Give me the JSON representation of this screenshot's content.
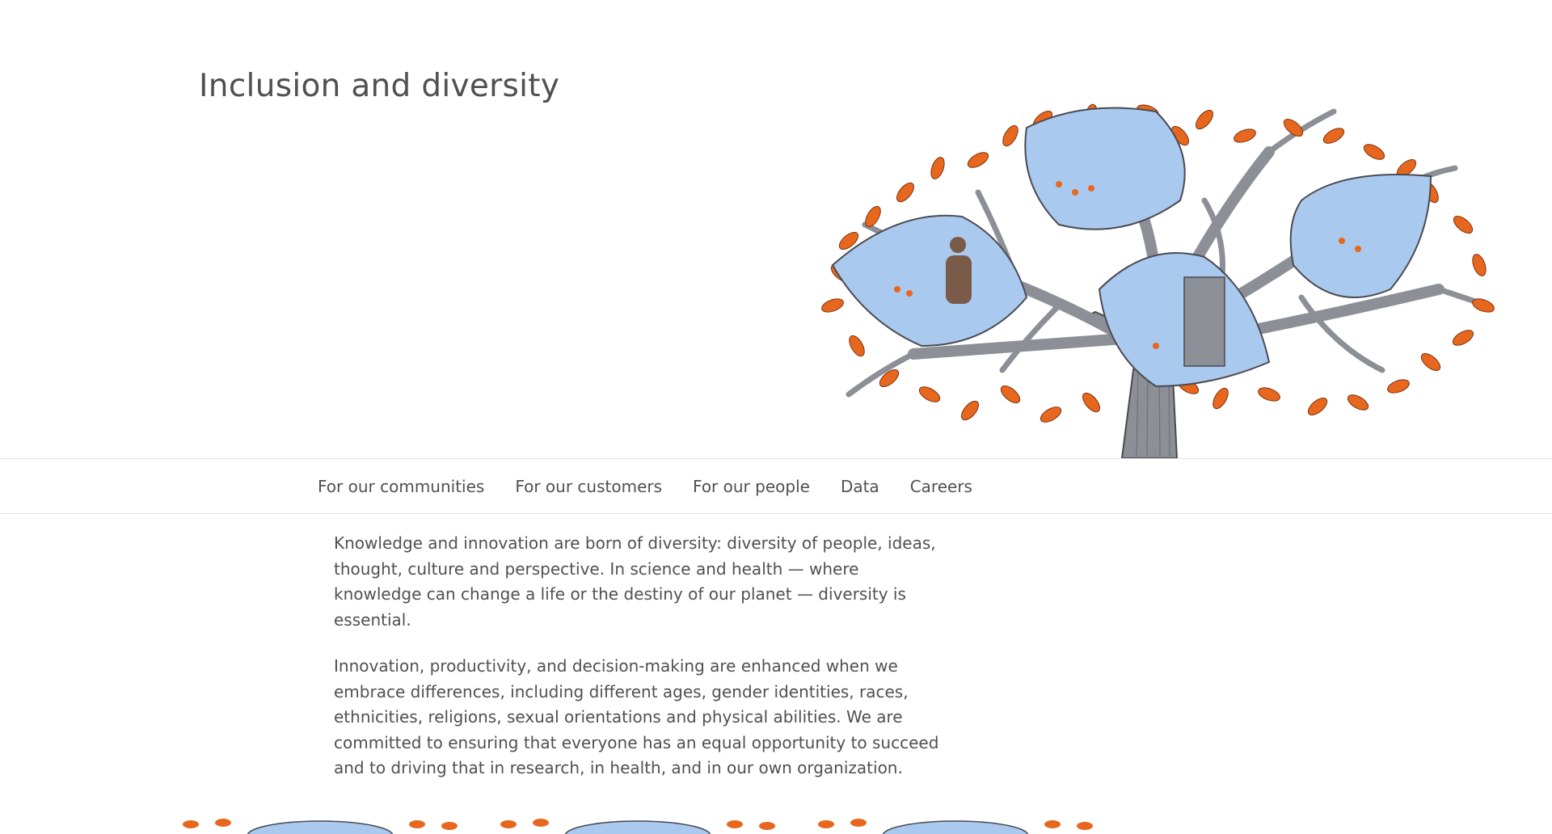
{
  "header": {
    "title": "Inclusion and diversity"
  },
  "hero_image": {
    "icon": "diversity-tree-illustration",
    "colors": {
      "leaf": "#e8671e",
      "pod": "#aac9ef",
      "branch": "#8c8f96",
      "outline": "#4a4a52"
    }
  },
  "nav": {
    "items": [
      {
        "label": "For our communities"
      },
      {
        "label": "For our customers"
      },
      {
        "label": "For our people"
      },
      {
        "label": "Data"
      },
      {
        "label": "Careers"
      }
    ]
  },
  "intro": {
    "paragraph_1": "Knowledge and innovation are born of diversity: diversity of people, ideas, thought, culture and perspective. In science and health — where knowledge can change a life or the destiny of our planet — diversity is essential.",
    "paragraph_2": "Innovation, productivity, and decision-making are enhanced when we embrace differences, including different ages, gender identities, races, ethnicities, religions, sexual orientations and physical abilities. We are committed to ensuring that everyone has an equal opportunity to succeed and to driving that in research, in health, and in our own organization."
  },
  "cards": [
    {
      "icon": "tree-thumbnail"
    },
    {
      "icon": "tree-thumbnail"
    },
    {
      "icon": "tree-thumbnail"
    }
  ]
}
